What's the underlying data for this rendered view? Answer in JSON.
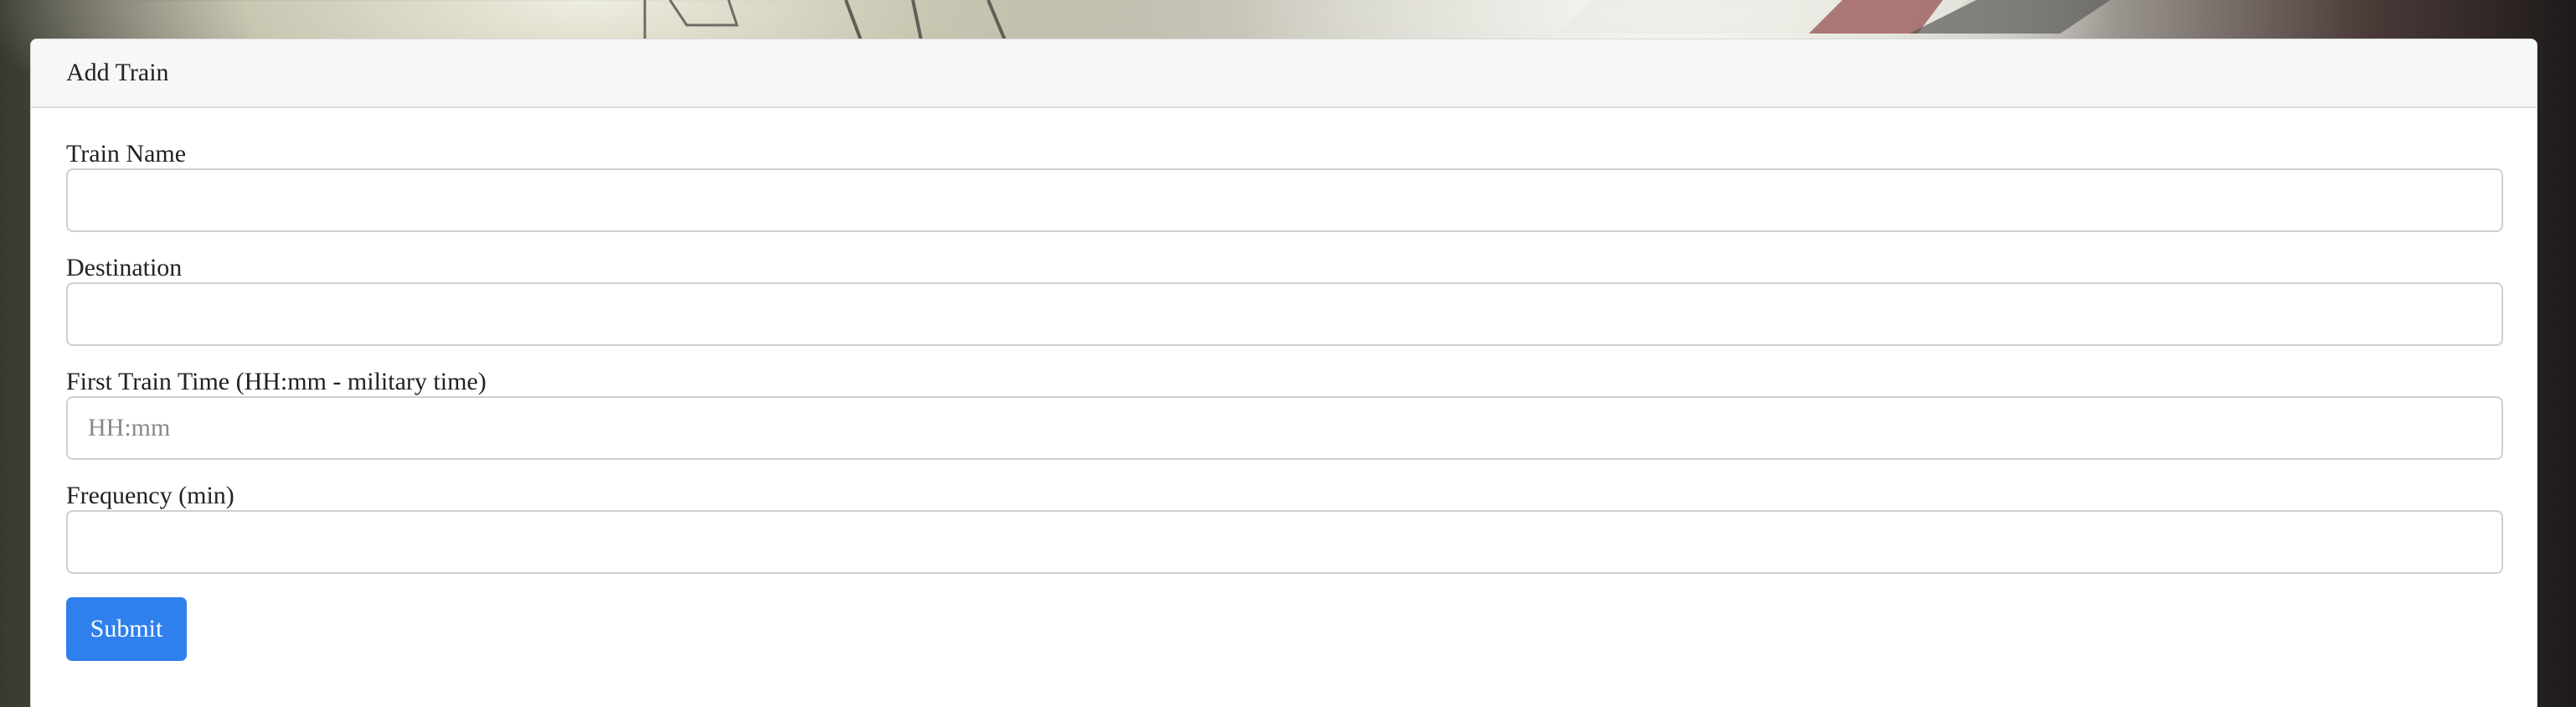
{
  "panel": {
    "title": "Add Train"
  },
  "form": {
    "train_name": {
      "label": "Train Name",
      "value": "",
      "placeholder": ""
    },
    "destination": {
      "label": "Destination",
      "value": "",
      "placeholder": ""
    },
    "first_train_time": {
      "label": "First Train Time (HH:mm - military time)",
      "value": "",
      "placeholder": "HH:mm"
    },
    "frequency": {
      "label": "Frequency (min)",
      "value": "",
      "placeholder": ""
    },
    "submit_label": "Submit"
  },
  "colors": {
    "submit_button": "#2f80ed",
    "heading_background": "#f7f7f7",
    "input_border": "#cfcfcf"
  }
}
